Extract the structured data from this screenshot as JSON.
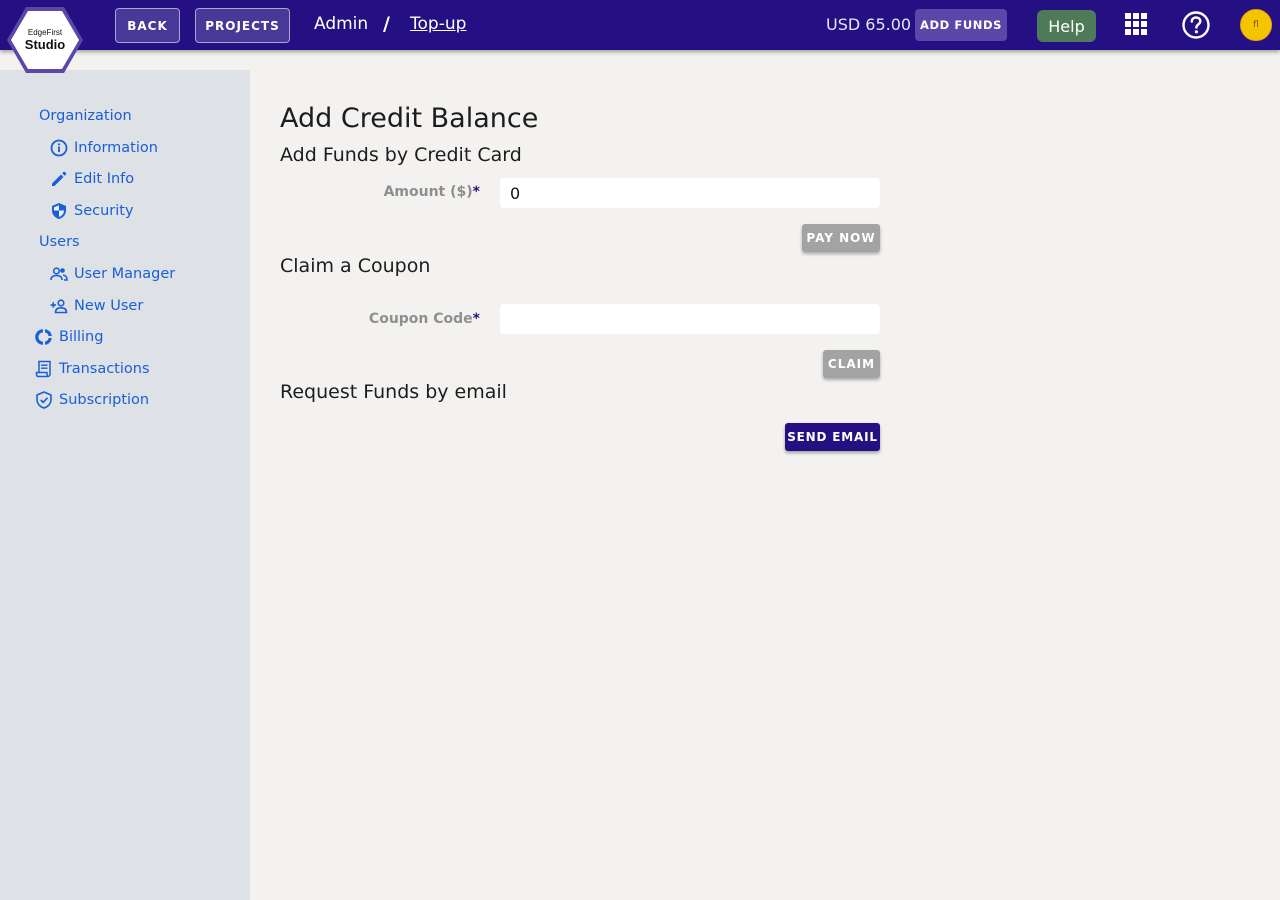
{
  "brand": {
    "logo_small": "EdgeFirst",
    "logo_big": "Studio"
  },
  "header": {
    "back_label": "BACK",
    "projects_label": "PROJECTS",
    "breadcrumb_admin": "Admin",
    "breadcrumb_separator": "/",
    "breadcrumb_current": "Top-up",
    "balance": "USD 65.00",
    "add_funds_label": "ADD FUNDS",
    "help_label": "Help",
    "avatar_initials": "fl"
  },
  "sidebar": {
    "items": [
      {
        "label": "Organization",
        "icon": "none"
      },
      {
        "label": "Information",
        "icon": "info-icon"
      },
      {
        "label": "Edit Info",
        "icon": "pencil-icon"
      },
      {
        "label": "Security",
        "icon": "shield-icon"
      },
      {
        "label": "Users",
        "icon": "none"
      },
      {
        "label": "User Manager",
        "icon": "people-icon"
      },
      {
        "label": "New User",
        "icon": "person-add-icon"
      },
      {
        "label": "Billing",
        "icon": "donut-icon"
      },
      {
        "label": "Transactions",
        "icon": "receipt-icon"
      },
      {
        "label": "Subscription",
        "icon": "shield-check-icon"
      }
    ]
  },
  "main": {
    "title": "Add Credit Balance",
    "credit_card": {
      "heading": "Add Funds by Credit Card",
      "amount_label": "Amount ($)",
      "required_mark": "*",
      "amount_value": "0",
      "pay_label": "PAY NOW"
    },
    "coupon": {
      "heading": "Claim a Coupon",
      "code_label": "Coupon Code",
      "required_mark": "*",
      "code_value": "",
      "claim_label": "CLAIM"
    },
    "email": {
      "heading": "Request Funds by email",
      "send_label": "SEND EMAIL"
    }
  },
  "colors": {
    "header_bg": "#241083",
    "sidebar_bg": "#dee1e6",
    "page_bg": "#f3f2f0",
    "link": "#1a5fd6",
    "help_bg": "#4f7a58",
    "avatar_bg": "#f5c400"
  }
}
